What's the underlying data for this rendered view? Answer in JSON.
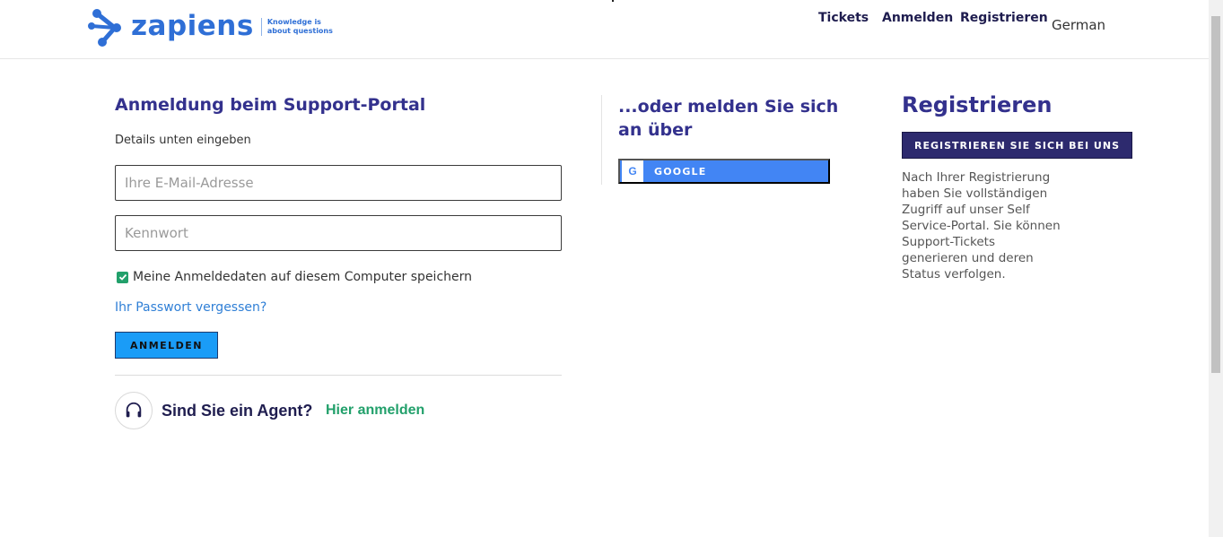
{
  "header": {
    "logo_text": "zapiens",
    "logo_tagline_1": "Knowledge is",
    "logo_tagline_2": "about questions",
    "nav": {
      "tickets": "Tickets",
      "login": "Anmelden",
      "register": "Registrieren",
      "language": "German"
    }
  },
  "login": {
    "title": "Anmeldung beim Support-Portal",
    "subtitle": "Details unten eingeben",
    "email_placeholder": "Ihre E-Mail-Adresse",
    "password_placeholder": "Kennwort",
    "remember_label": "Meine Anmeldedaten auf diesem Computer speichern",
    "remember_checked": true,
    "forgot_password": "Ihr Passwort vergessen?",
    "submit_label": "ANMELDEN",
    "agent_question": "Sind Sie ein Agent?",
    "agent_link": "Hier anmelden"
  },
  "social": {
    "title": "...oder melden Sie sich an über",
    "google_label": "GOOGLE",
    "google_icon_letter": "G"
  },
  "register": {
    "title": "Registrieren",
    "button_label": "REGISTRIEREN SIE SICH BEI UNS",
    "description": "Nach Ihrer Registrierung haben Sie vollständigen Zugriff auf unser Self Service-Portal. Sie können Support-Tickets generieren und deren Status verfolgen."
  },
  "colors": {
    "heading": "#33318d",
    "accent_blue": "#1a9cf7",
    "google_blue": "#4285f4",
    "register_button": "#2d2a6e",
    "agent_link_green": "#22a06b"
  }
}
